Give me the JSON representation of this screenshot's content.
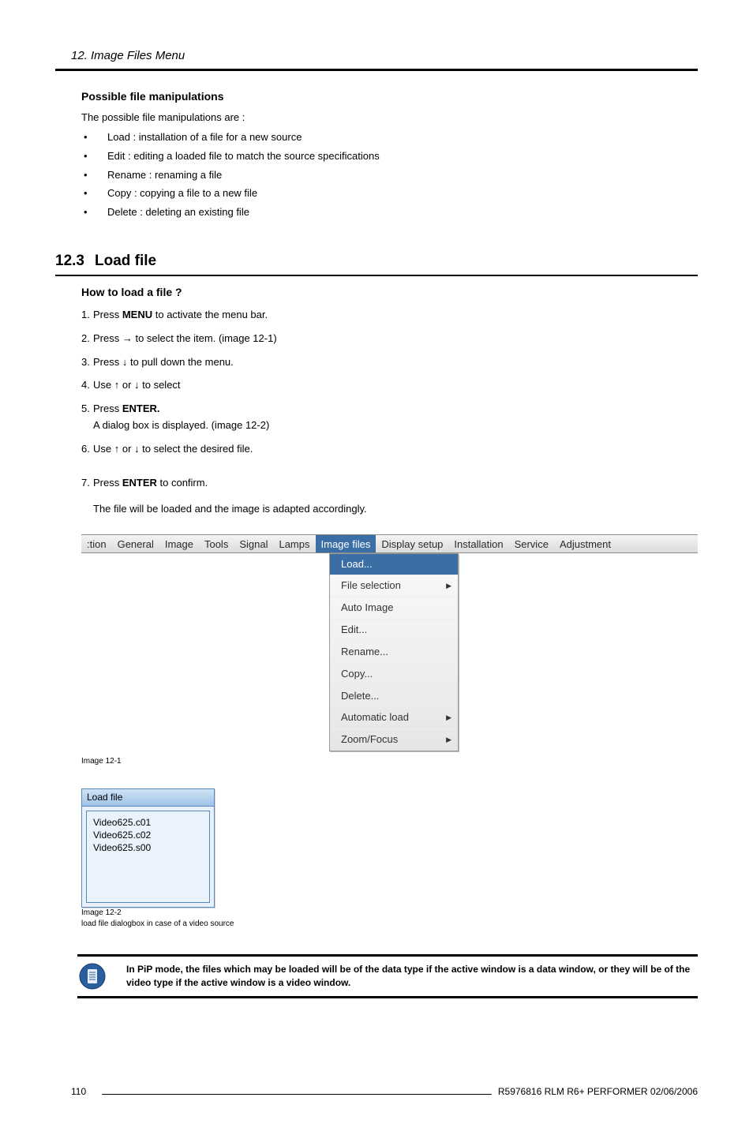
{
  "chapter": "12.  Image Files Menu",
  "section_manip": {
    "heading": "Possible file manipulations",
    "intro": "The possible file manipulations are :",
    "items": [
      "Load :  installation of a file for a new source",
      "Edit :  editing a loaded file to match the source specifications",
      "Rename :  renaming a file",
      "Copy :  copying a file to a new file",
      "Delete :  deleting an existing file"
    ]
  },
  "section_load": {
    "number": "12.3",
    "title": "Load file",
    "sub_heading": "How to load a file ?",
    "steps": {
      "s1_pre": "Press ",
      "s1_bold": "MENU",
      "s1_post": " to activate the menu bar.",
      "s2": "Press → to select the                     item.  (image 12-1)",
      "s3": "Press ↓ to pull down the                     menu.",
      "s4": "Use ↑ or ↓ to select",
      "s5_pre": "Press ",
      "s5_bold": "ENTER.",
      "s5_sub": "A dialog box is displayed.  (image 12-2)",
      "s6": "Use ↑ or ↓ to select the desired file.",
      "s7_pre": "Press ",
      "s7_bold": "ENTER",
      "s7_post": " to confirm.",
      "s7_note": "The file will be loaded and the image is adapted accordingly."
    }
  },
  "fig121": {
    "menu": [
      ":tion",
      "General",
      "Image",
      "Tools",
      "Signal",
      "Lamps",
      "Image files",
      "Display setup",
      "Installation",
      "Service",
      "Adjustment"
    ],
    "selected": "Image files",
    "dropdown": [
      {
        "label": "Load...",
        "sel": true,
        "sub": false
      },
      {
        "label": "File selection",
        "sel": false,
        "sub": true
      },
      {
        "label": "Auto Image",
        "sel": false,
        "sub": false
      },
      {
        "label": "Edit...",
        "sel": false,
        "sub": false
      },
      {
        "label": "Rename...",
        "sel": false,
        "sub": false
      },
      {
        "label": "Copy...",
        "sel": false,
        "sub": false
      },
      {
        "label": "Delete...",
        "sel": false,
        "sub": false
      },
      {
        "label": "Automatic load",
        "sel": false,
        "sub": true
      },
      {
        "label": "Zoom/Focus",
        "sel": false,
        "sub": true
      }
    ],
    "caption": "Image 12-1"
  },
  "fig122": {
    "title": "Load file",
    "items": [
      "Video625.c01",
      "Video625.c02",
      "Video625.s00"
    ],
    "caption": "Image 12-2",
    "caption_sub": "load file dialogbox in case of a video source"
  },
  "note": "In PiP mode, the files which may be loaded will be of the data type if the active window is a data window, or they will be of the video type if the active window is a video window.",
  "footer": {
    "page": "110",
    "doc": "R5976816  RLM R6+ PERFORMER  02/06/2006"
  }
}
